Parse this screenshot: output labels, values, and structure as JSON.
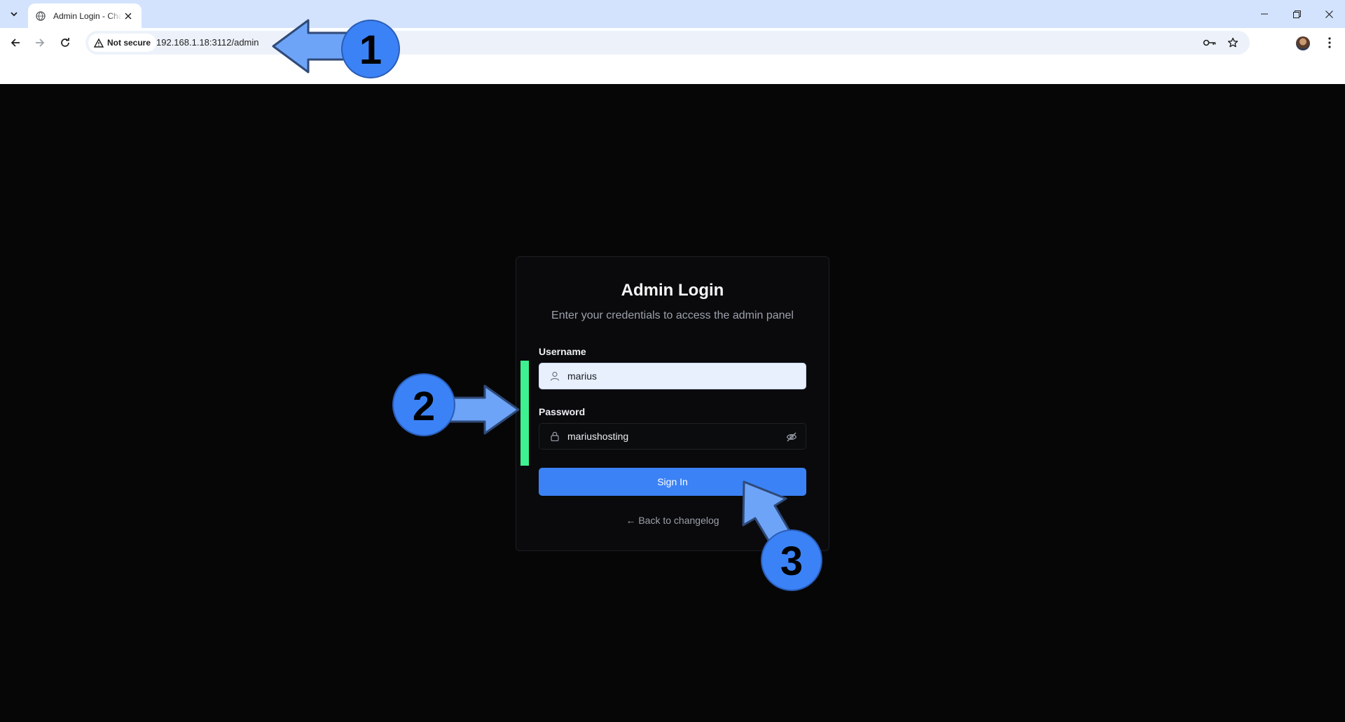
{
  "browser": {
    "tab_title": "Admin Login - Changelog",
    "chip_text": "Not secure",
    "url": "192.168.1.18:3112/admin",
    "icons": [
      "tab-search-icon",
      "globe-icon",
      "close-icon",
      "minimize-icon",
      "restore-icon",
      "back-icon",
      "forward-icon",
      "reload-icon",
      "warning-icon",
      "password-key-icon",
      "star-icon",
      "avatar",
      "menu-icon"
    ]
  },
  "login": {
    "title": "Admin Login",
    "subtitle": "Enter your credentials to access the admin panel",
    "username_label": "Username",
    "username_value": "marius",
    "password_label": "Password",
    "password_value": "mariushosting",
    "submit_label": "Sign In",
    "back_link": "← Back to changelog"
  },
  "annotations": {
    "step1": "1",
    "step2": "2",
    "step3": "3",
    "arrow_color": "#6ea4f7",
    "badge_color": "#3b82f6",
    "highlight_color": "#3ef08f"
  },
  "colors": {
    "page_bg": "#060607",
    "button": "#3b82f6",
    "chrome_tabbar": "#d3e3fd"
  }
}
